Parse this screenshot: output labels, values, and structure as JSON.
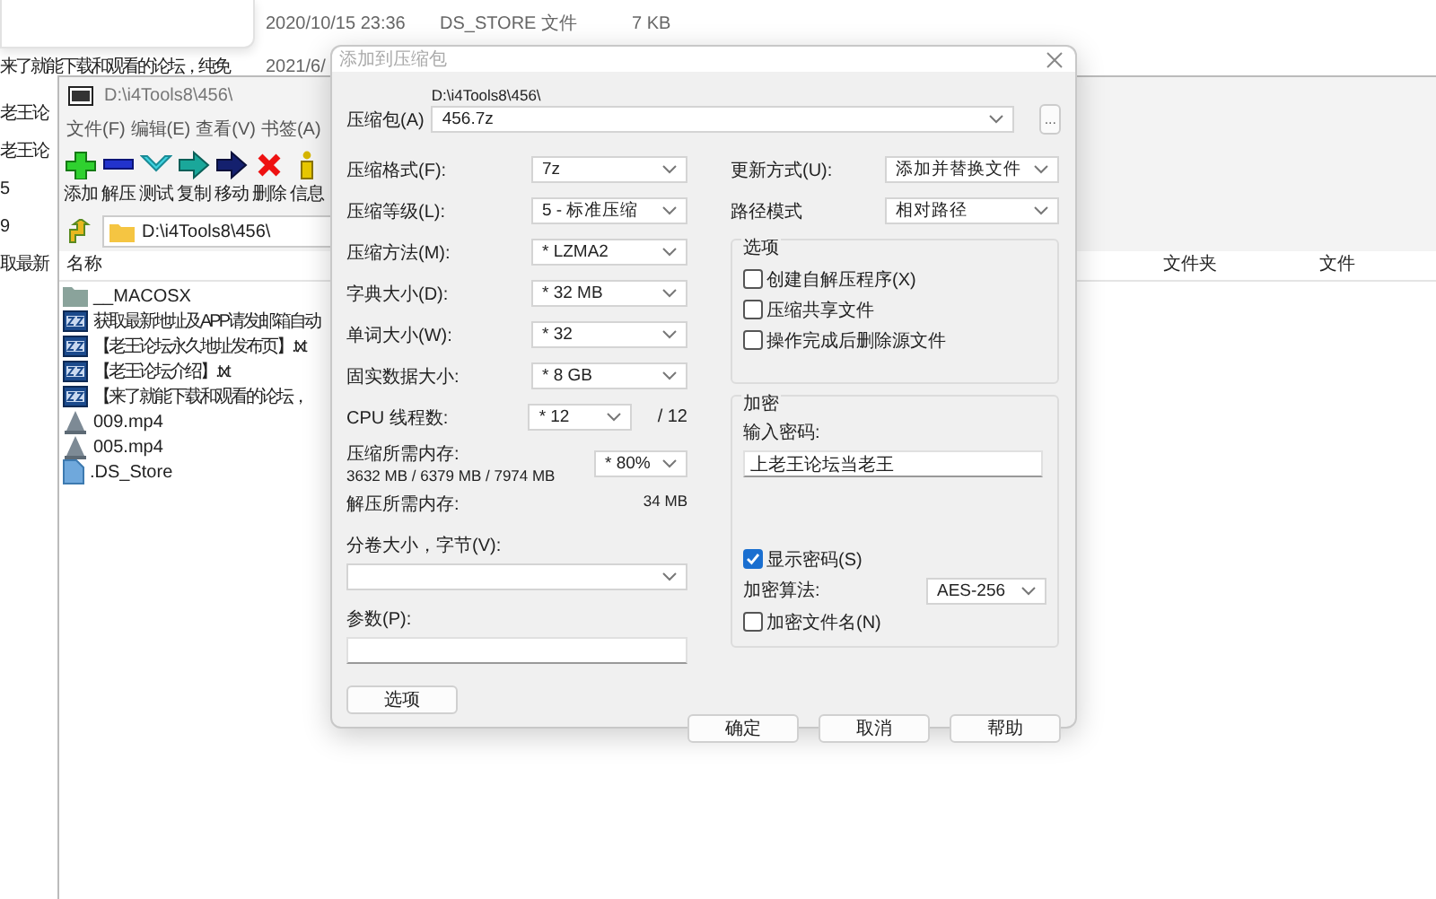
{
  "background_rows": [
    {
      "date": "2020/10/15 23:36",
      "type": "DS_STORE 文件",
      "size": "7 KB"
    },
    {
      "name": "来了就能下载和观看的论坛，纯免",
      "date": "2021/6/"
    }
  ],
  "left_fragments": [
    "老王论",
    "老王论",
    "5",
    "9",
    "取最新"
  ],
  "file_manager": {
    "title": "D:\\i4Tools8\\456\\",
    "menu": [
      "文件(F)",
      "编辑(E)",
      "查看(V)",
      "书签(A)"
    ],
    "toolbar": [
      {
        "kind": "add",
        "label": "添加"
      },
      {
        "kind": "extract",
        "label": "解压"
      },
      {
        "kind": "test",
        "label": "测试"
      },
      {
        "kind": "copy",
        "label": "复制"
      },
      {
        "kind": "move",
        "label": "移动"
      },
      {
        "kind": "delete",
        "label": "删除"
      },
      {
        "kind": "info",
        "label": "信息"
      }
    ],
    "address": "D:\\i4Tools8\\456\\",
    "columns": [
      "名称",
      "文件夹",
      "文件"
    ],
    "files": [
      {
        "kind": "folder",
        "name": "__MACOSX"
      },
      {
        "kind": "text",
        "name": "获取最新地址及APP请发邮箱自动"
      },
      {
        "kind": "text",
        "name": "【老王论坛永久地址发布页】.txt"
      },
      {
        "kind": "text",
        "name": "【老王论坛介绍】.txt"
      },
      {
        "kind": "text",
        "name": "【来了就能下载和观看的论坛，"
      },
      {
        "kind": "video",
        "name": "009.mp4"
      },
      {
        "kind": "video",
        "name": "005.mp4"
      },
      {
        "kind": "file",
        "name": ".DS_Store"
      }
    ]
  },
  "dialog": {
    "title": "添加到压缩包",
    "archive": {
      "label": "压缩包(A)",
      "folder": "D:\\i4Tools8\\456\\",
      "value": "456.7z",
      "browse": "..."
    },
    "left_selects": [
      {
        "label": "压缩格式(F):",
        "value": "7z"
      },
      {
        "label": "压缩等级(L):",
        "value": "5 - 标准压缩"
      },
      {
        "label": "压缩方法(M):",
        "value": "* LZMA2"
      },
      {
        "label": "字典大小(D):",
        "value": "* 32 MB"
      },
      {
        "label": "单词大小(W):",
        "value": "* 32"
      },
      {
        "label": "固实数据大小:",
        "value": "* 8 GB"
      },
      {
        "label": "CPU 线程数:",
        "value": "* 12",
        "suffix": "/ 12"
      }
    ],
    "memory": {
      "label": "压缩所需内存:",
      "detail": "3632 MB / 6379 MB / 7974 MB",
      "value": "* 80%"
    },
    "decompress": {
      "label": "解压所需内存:",
      "value": "34 MB"
    },
    "split": {
      "label": "分卷大小，字节(V):"
    },
    "params": {
      "label": "参数(P):"
    },
    "options_button": "选项",
    "update": {
      "label": "更新方式(U):",
      "value": "添加并替换文件"
    },
    "path_mode": {
      "label": "路径模式",
      "value": "相对路径"
    },
    "options": {
      "title": "选项",
      "items": [
        {
          "label": "创建自解压程序(X)",
          "checked": false
        },
        {
          "label": "压缩共享文件",
          "checked": false
        },
        {
          "label": "操作完成后删除源文件",
          "checked": false
        }
      ]
    },
    "encryption": {
      "title": "加密",
      "password_label": "输入密码:",
      "password": "上老王论坛当老王",
      "show_password": {
        "label": "显示密码(S)",
        "checked": true
      },
      "method_label": "加密算法:",
      "method": "AES-256",
      "encrypt_names": {
        "label": "加密文件名(N)",
        "checked": false
      }
    },
    "buttons": [
      "确定",
      "取消",
      "帮助"
    ]
  }
}
